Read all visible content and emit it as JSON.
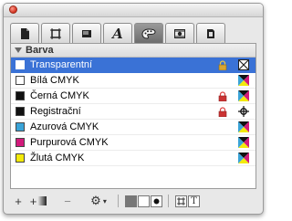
{
  "window": {
    "title": ""
  },
  "tabs": [
    {
      "icon": "page-icon"
    },
    {
      "icon": "frame-icon"
    },
    {
      "icon": "box-icon"
    },
    {
      "icon": "text-style-icon"
    },
    {
      "icon": "color-palette-icon",
      "active": true
    },
    {
      "icon": "image-icon"
    },
    {
      "icon": "ebook-icon"
    }
  ],
  "panel": {
    "section_label": "Barva",
    "colors": [
      {
        "name": "Transparentní",
        "swatch": "none",
        "locked": true,
        "mode": "none",
        "selected": true
      },
      {
        "name": "Bílá CMYK",
        "swatch": "#ffffff",
        "locked": false,
        "mode": "cmyk"
      },
      {
        "name": "Černá CMYK",
        "swatch": "#111111",
        "locked": true,
        "mode": "cmyk"
      },
      {
        "name": "Registrační",
        "swatch": "#111111",
        "locked": true,
        "mode": "registration"
      },
      {
        "name": "Azurová CMYK",
        "swatch": "#3aa4d8",
        "locked": false,
        "mode": "cmyk"
      },
      {
        "name": "Purpurová CMYK",
        "swatch": "#d21a7b",
        "locked": false,
        "mode": "cmyk"
      },
      {
        "name": "Žlutá CMYK",
        "swatch": "#f3ea0a",
        "locked": false,
        "mode": "cmyk"
      }
    ]
  },
  "bottom_bar": {
    "add_label": "+",
    "add_gradient_label": "+",
    "remove_label": "−",
    "options_label": "⚙"
  },
  "colors": {
    "selection": "#3a72d6",
    "close": "#d2301f"
  }
}
